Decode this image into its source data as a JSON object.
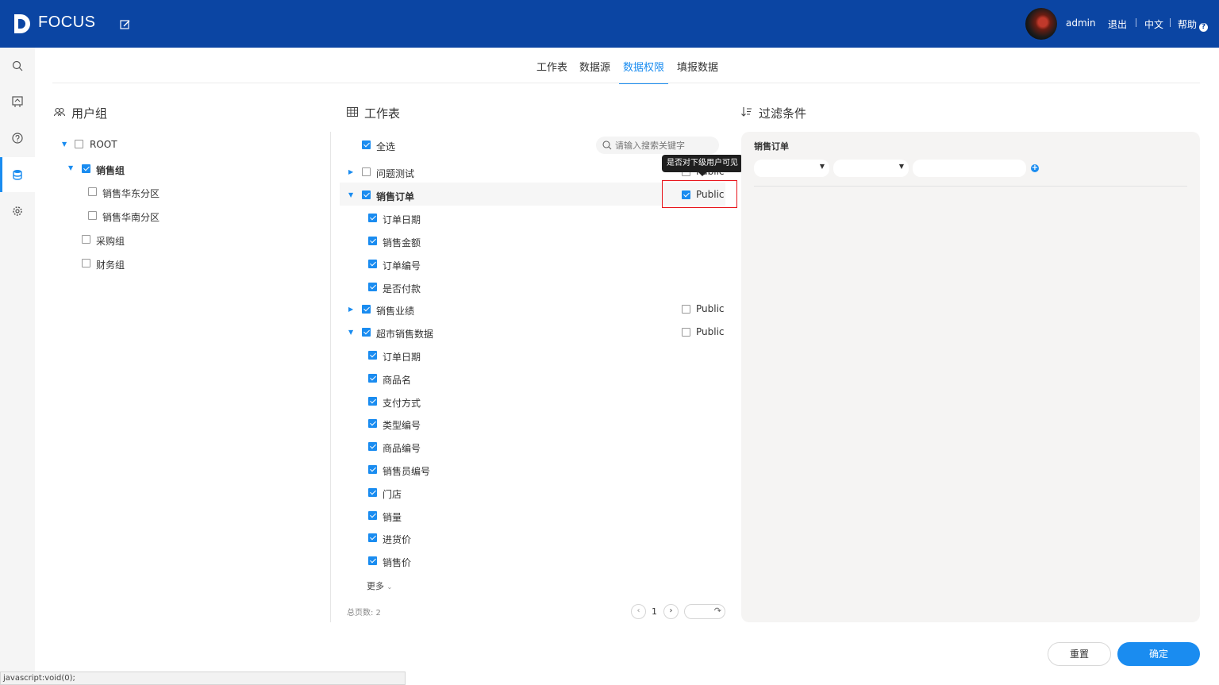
{
  "header": {
    "brand": "FOCUS",
    "username": "admin",
    "logout": "退出",
    "language": "中文",
    "help": "帮助",
    "help_icon_glyph": "?"
  },
  "sidebar": {
    "icons": [
      "search-icon",
      "bookmark-icon",
      "help-icon",
      "database-icon",
      "gear-icon"
    ],
    "active_index": 3
  },
  "tabs": [
    {
      "label": "工作表",
      "active": false
    },
    {
      "label": "数据源",
      "active": false
    },
    {
      "label": "数据权限",
      "active": true
    },
    {
      "label": "填报数据",
      "active": false
    }
  ],
  "user_groups": {
    "title": "用户组",
    "tree": [
      {
        "label": "ROOT",
        "checked": false,
        "expanded": true
      },
      {
        "label": "销售组",
        "checked": true,
        "expanded": true,
        "bold": true
      },
      {
        "label": "销售华东分区",
        "checked": false
      },
      {
        "label": "销售华南分区",
        "checked": false
      },
      {
        "label": "采购组",
        "checked": false
      },
      {
        "label": "财务组",
        "checked": false
      }
    ]
  },
  "worksheets": {
    "title": "工作表",
    "select_all": "全选",
    "search_placeholder": "请输入搜索关键字",
    "public_tooltip": "是否对下级用户可见",
    "public_label": "Public",
    "rows": [
      {
        "label": "问题测试",
        "checked": false,
        "public": false
      },
      {
        "label": "销售订单",
        "checked": true,
        "public": true,
        "bold": true
      },
      {
        "label": "订单日期",
        "checked": true
      },
      {
        "label": "销售金额",
        "checked": true
      },
      {
        "label": "订单编号",
        "checked": true
      },
      {
        "label": "是否付款",
        "checked": true
      },
      {
        "label": "销售业绩",
        "checked": true,
        "public": false
      },
      {
        "label": "超市销售数据",
        "checked": true,
        "public": false
      },
      {
        "label": "订单日期",
        "checked": true
      },
      {
        "label": "商品名",
        "checked": true
      },
      {
        "label": "支付方式",
        "checked": true
      },
      {
        "label": "类型编号",
        "checked": true
      },
      {
        "label": "商品编号",
        "checked": true
      },
      {
        "label": "销售员编号",
        "checked": true
      },
      {
        "label": "门店",
        "checked": true
      },
      {
        "label": "销量",
        "checked": true
      },
      {
        "label": "进货价",
        "checked": true
      },
      {
        "label": "销售价",
        "checked": true
      }
    ],
    "more": "更多",
    "total_pages": "总页数: 2",
    "current_page": "1"
  },
  "filter": {
    "title": "过滤条件",
    "sheet_name": "销售订单",
    "add_glyph": "+"
  },
  "actions": {
    "reset": "重置",
    "confirm": "确定"
  },
  "status_bar": "javascript:void(0);",
  "colors": {
    "header": "#0b45a3",
    "accent": "#1a8cf0",
    "highlight_border": "#e8141b"
  }
}
